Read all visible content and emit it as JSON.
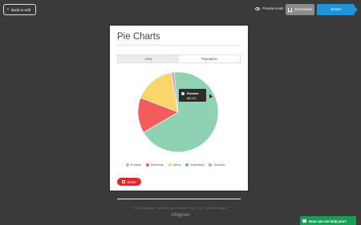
{
  "topbar": {
    "back_label": "Back to edit",
    "preview_label": "Preview mode",
    "download_label": "Download",
    "share_label": "Share"
  },
  "card": {
    "title": "Pie Charts",
    "tabs": [
      {
        "label": "Area",
        "active": false
      },
      {
        "label": "Population",
        "active": true
      }
    ],
    "tooltip": {
      "name": "Eurasia",
      "value": "68.1%"
    },
    "share_label": "Share"
  },
  "chart_data": {
    "type": "pie",
    "categories": [
      "Eurasia",
      "Americas",
      "Africa",
      "Antarctica",
      "Oceania"
    ],
    "values": [
      68.1,
      14.3,
      16.5,
      0.0,
      1.1
    ],
    "colors": [
      "#8ed1b3",
      "#f35c5c",
      "#f8d66c",
      "#4ab8e6",
      "#c99ad8"
    ],
    "legend_position": "bottom"
  },
  "footer": {
    "links": "©2016 Infogram · Terms of Use · Privacy Policy · FAQ · Contact Support",
    "logo": "infogram"
  },
  "help": {
    "label": "How can we help you?"
  }
}
